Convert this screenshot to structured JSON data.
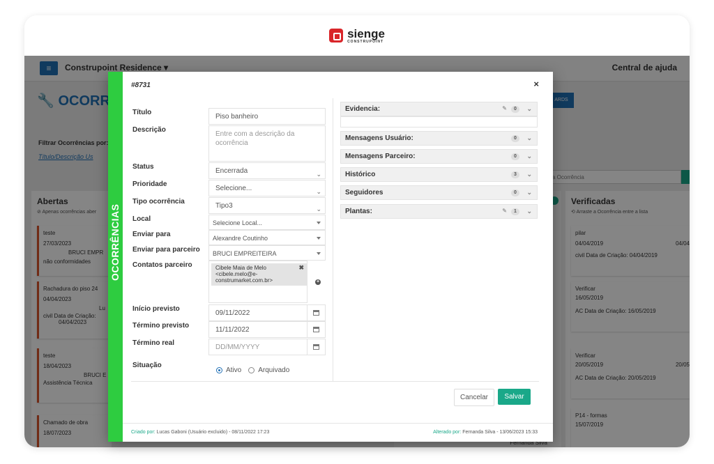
{
  "brand": {
    "name": "sienge",
    "sub": "CONSTRUPOINT"
  },
  "topbar": {
    "project": "Construpoint Residence",
    "help": "Central de ajuda"
  },
  "page": {
    "title": "OCORRÊN",
    "dash_label": "ARDS"
  },
  "filter": {
    "label": "Filtrar Ocorrências por:",
    "link": "Título/Descrição Us"
  },
  "search": {
    "placeholder": "a Ocorrência"
  },
  "columns": {
    "left": {
      "title": "Abertas",
      "sub": "Apenas ocorrências aber",
      "cards": [
        {
          "title": "teste",
          "date": "27/03/2023",
          "who": "BRUCI EMPR",
          "tag": "não conformidades"
        },
        {
          "title": "Rachadura do piso 24",
          "date": "04/04/2023",
          "who": "Lu",
          "tag": "civil  Data de Criação:",
          "date2": "04/04/2023"
        },
        {
          "title": "teste",
          "date": "18/04/2023",
          "who": "BRUCI E",
          "tag": "Assistência Técnica"
        },
        {
          "title": "Chamado de obra",
          "date": "18/07/2023"
        }
      ]
    },
    "right": {
      "title": "Verificadas",
      "sub": "Arraste a Ocorrência entre a lista",
      "cards": [
        {
          "title": "pilar",
          "date": "04/04/2019",
          "date_r": "04/04",
          "tag": "civil  Data de Criação: 04/04/2019"
        },
        {
          "title": "Verificar",
          "date": "16/05/2019",
          "tag": "AC  Data de Criação: 16/05/2019"
        },
        {
          "title": "Verificar",
          "date": "20/05/2019",
          "date_r": "20/05",
          "tag": "AC  Data de Criação: 20/05/2019"
        },
        {
          "title": "P14 - formas",
          "date": "15/07/2019"
        }
      ]
    },
    "mid_footer": "Fernanda Silva"
  },
  "modal": {
    "id": "#8731",
    "sidebar": "OCORRÊNCIAS",
    "close": "×",
    "fields": {
      "titulo": {
        "label": "Título",
        "value": "Piso banheiro"
      },
      "descricao": {
        "label": "Descrição",
        "placeholder": "Entre com a descrição da ocorrência"
      },
      "status": {
        "label": "Status",
        "value": "Encerrada"
      },
      "prioridade": {
        "label": "Prioridade",
        "value": "Selecione..."
      },
      "tipo": {
        "label": "Tipo ocorrência",
        "value": "Tipo3"
      },
      "local": {
        "label": "Local",
        "value": "Selecione Local..."
      },
      "enviar_para": {
        "label": "Enviar para",
        "value": "Alexandre Coutinho"
      },
      "enviar_parceiro": {
        "label": "Enviar para parceiro",
        "value": "BRUCI EMPREITEIRA"
      },
      "contatos": {
        "label": "Contatos parceiro",
        "contact_name": "Cibele Maia de Melo",
        "contact_email": "<cibele.melo@e-",
        "contact_email2": "construmarket.com.br>"
      },
      "inicio": {
        "label": "Início previsto",
        "value": "09/11/2022"
      },
      "termino": {
        "label": "Término previsto",
        "value": "11/11/2022"
      },
      "termino_real": {
        "label": "Término real",
        "placeholder": "DD/MM/YYYY"
      },
      "situacao": {
        "label": "Situação",
        "ativo": "Ativo",
        "arquivado": "Arquivado"
      }
    },
    "panels": [
      {
        "label": "Evidencia:",
        "count": "0",
        "clip": true
      },
      {
        "label": "Mensagens Usuário:",
        "count": "0"
      },
      {
        "label": "Mensagens Parceiro:",
        "count": "0"
      },
      {
        "label": "Histórico",
        "count": "3"
      },
      {
        "label": "Seguidores",
        "count": "0"
      },
      {
        "label": "Plantas:",
        "count": "1",
        "clip": true
      }
    ],
    "buttons": {
      "cancel": "Cancelar",
      "save": "Salvar"
    },
    "footer": {
      "created_label": "Criado por:",
      "created_value": "Lucas Gaboni (Usuário excluido) - 08/11/2022 17:23",
      "changed_label": "Alterado por:",
      "changed_value": "Fernanda Silva - 13/06/2023 15:33"
    }
  },
  "colors": {
    "green": "#2ecc40",
    "teal": "#1aa889",
    "blue": "#1f6fb5",
    "orange": "#d9542b"
  }
}
